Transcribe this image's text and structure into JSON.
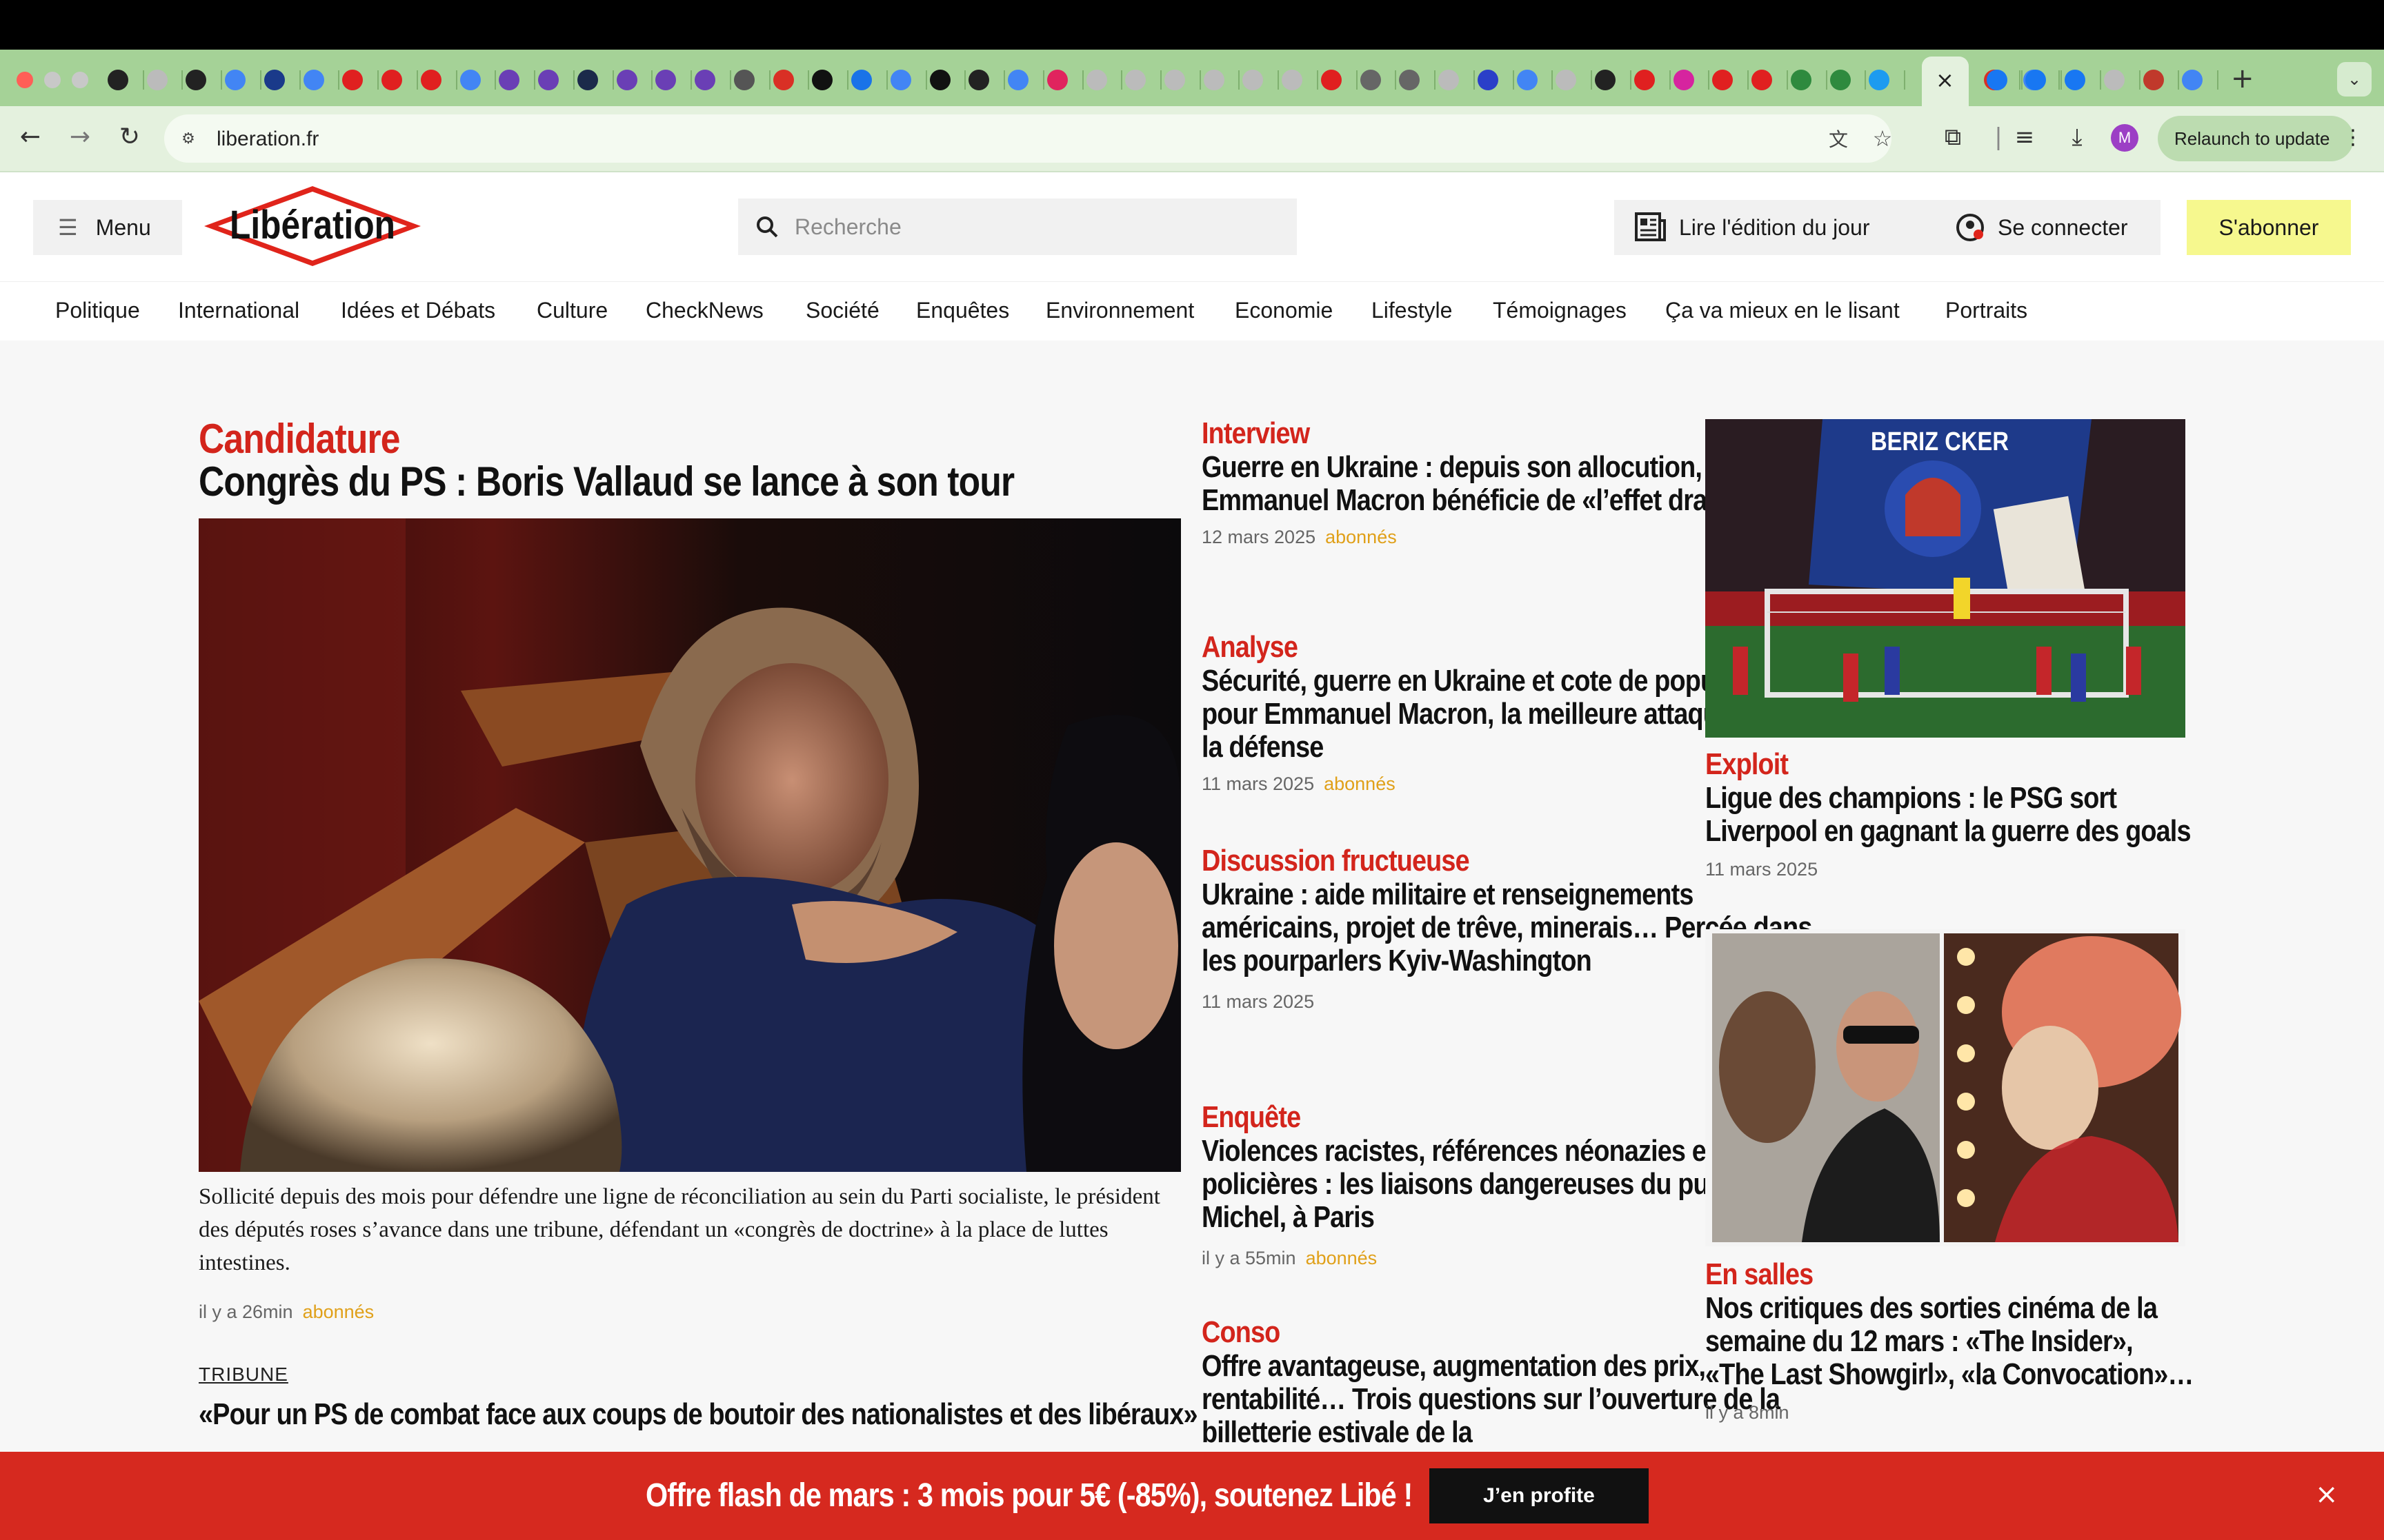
{
  "browser": {
    "url": "liberation.fr",
    "relaunch_label": "Relaunch to update",
    "avatar_letter": "M",
    "new_tab_symbol": "+",
    "close_tab_symbol": "×",
    "tab_icons": [
      {
        "icon": "openai-icon",
        "color": "#222"
      },
      {
        "icon": "tab-icon",
        "color": "#bbb"
      },
      {
        "icon": "openai-icon",
        "color": "#222"
      },
      {
        "icon": "google-icon",
        "color": "#4285f4"
      },
      {
        "icon": "dwds-icon",
        "color": "#1a3a8a"
      },
      {
        "icon": "google-icon",
        "color": "#4285f4"
      },
      {
        "icon": "youtube-icon",
        "color": "#e02020"
      },
      {
        "icon": "youtube-icon",
        "color": "#e02020"
      },
      {
        "icon": "youtube-icon",
        "color": "#e02020"
      },
      {
        "icon": "google-icon",
        "color": "#4285f4"
      },
      {
        "icon": "app-icon",
        "color": "#6a3fb5"
      },
      {
        "icon": "app-icon",
        "color": "#6a3fb5"
      },
      {
        "icon": "app-icon",
        "color": "#1b2a4a"
      },
      {
        "icon": "app-icon",
        "color": "#6a3fb5"
      },
      {
        "icon": "app-icon",
        "color": "#6a3fb5"
      },
      {
        "icon": "app-icon",
        "color": "#6a3fb5"
      },
      {
        "icon": "chrome-icon",
        "color": "#555"
      },
      {
        "icon": "gmail-icon",
        "color": "#d93025"
      },
      {
        "icon": "app-icon",
        "color": "#111"
      },
      {
        "icon": "contacts-icon",
        "color": "#1a73e8"
      },
      {
        "icon": "docs-icon",
        "color": "#4285f4"
      },
      {
        "icon": "app-icon",
        "color": "#111"
      },
      {
        "icon": "github-icon",
        "color": "#222"
      },
      {
        "icon": "google-icon",
        "color": "#4285f4"
      },
      {
        "icon": "app-icon",
        "color": "#e0245e"
      },
      {
        "icon": "tab-icon",
        "color": "#bbb"
      },
      {
        "icon": "tab-icon",
        "color": "#bbb"
      },
      {
        "icon": "tab-icon",
        "color": "#bbb"
      },
      {
        "icon": "tab-icon",
        "color": "#bbb"
      },
      {
        "icon": "tab-icon",
        "color": "#bbb"
      },
      {
        "icon": "tab-icon",
        "color": "#bbb"
      },
      {
        "icon": "youtube-icon",
        "color": "#e02020"
      },
      {
        "icon": "globe-icon",
        "color": "#666"
      },
      {
        "icon": "globe-icon",
        "color": "#666"
      },
      {
        "icon": "tab-icon",
        "color": "#bbb"
      },
      {
        "icon": "20min-icon",
        "color": "#2a3fc8"
      },
      {
        "icon": "google-icon",
        "color": "#4285f4"
      },
      {
        "icon": "tab-icon",
        "color": "#bbb"
      },
      {
        "icon": "openai-icon",
        "color": "#222"
      },
      {
        "icon": "youtube-icon",
        "color": "#e02020"
      },
      {
        "icon": "instagram-icon",
        "color": "#d6249f"
      },
      {
        "icon": "youtube-icon",
        "color": "#e02020"
      },
      {
        "icon": "youtube-icon",
        "color": "#e02020"
      },
      {
        "icon": "wordpress-icon",
        "color": "#2e8a3e"
      },
      {
        "icon": "wordpress-icon",
        "color": "#2e8a3e"
      },
      {
        "icon": "twitter-icon",
        "color": "#1d9bf0"
      },
      {
        "icon": "gmail-icon",
        "color": "#d93025"
      },
      {
        "icon": "google-icon",
        "color": "#4285f4"
      },
      {
        "icon": "facebook-icon",
        "color": "#1877f2"
      },
      {
        "icon": "facebook-icon",
        "color": "#1877f2"
      },
      {
        "icon": "facebook-icon",
        "color": "#1877f2"
      },
      {
        "icon": "tab-icon",
        "color": "#bbb"
      },
      {
        "icon": "app-icon",
        "color": "#c0392b"
      },
      {
        "icon": "google-icon",
        "color": "#4285f4"
      }
    ]
  },
  "site": {
    "menu_label": "Menu",
    "logo_text": "Libération",
    "search_placeholder": "Recherche",
    "edition_label": "Lire l'édition du jour",
    "connect_label": "Se connecter",
    "subscribe_label": "S'abonner",
    "categories": [
      "Politique",
      "International",
      "Idées et Débats",
      "Culture",
      "CheckNews",
      "Société",
      "Enquêtes",
      "Environnement",
      "Economie",
      "Lifestyle",
      "Témoignages",
      "Ça va mieux en le lisant",
      "Portraits"
    ],
    "brand_red": "#d3251c",
    "subscriber_color": "#e0a019"
  },
  "main_article": {
    "kicker": "Candidature",
    "title": "Congrès du PS : Boris Vallaud se lance à son tour",
    "description": "Sollicité depuis des mois pour défendre une ligne de réconciliation au sein du Parti socialiste, le président des députés roses s’avance dans une tribune, défendant un «congrès de doctrine» à la place de luttes intestines.",
    "time": "il y a 26min",
    "badge": "abonnés",
    "related_label": "TRIBUNE",
    "related_title": "«Pour un PS de combat face aux coups de boutoir des nationalistes et des libéraux»"
  },
  "middle_articles": [
    {
      "kicker": "Interview",
      "title": "Guerre en Ukraine : depuis son allocution, Emmanuel Macron bénéficie de «l’effet drapeau»",
      "date": "12 mars 2025",
      "badge": "abonnés"
    },
    {
      "kicker": "Analyse",
      "title": "Sécurité, guerre en Ukraine et cote de popularité : pour Emmanuel Macron, la meilleure attaque c’est la défense",
      "date": "11 mars 2025",
      "badge": "abonnés"
    },
    {
      "kicker": "Discussion fructueuse",
      "title": "Ukraine : aide militaire et renseignements américains, projet de trêve, minerais… Percée dans les pourparlers Kyiv-Washington",
      "date": "11 mars 2025",
      "badge": ""
    },
    {
      "kicker": "Enquête",
      "title": "Violences racistes, références néonazies et amitiés policières : les liaisons dangereuses du pub Saint-Michel, à Paris",
      "date": "il y a 55min",
      "badge": "abonnés"
    },
    {
      "kicker": "Conso",
      "title": "Offre avantageuse, augmentation des prix, rentabilité… Trois questions sur l’ouverture de la billetterie estivale de la",
      "date": "",
      "badge": ""
    }
  ],
  "right_articles": [
    {
      "kicker": "Exploit",
      "title": "Ligue des champions : le PSG sort Liverpool en gagnant la guerre des goals",
      "date": "11 mars 2025",
      "banner_text": "BERIZ CKER"
    },
    {
      "kicker": "En salles",
      "title": "Nos critiques des sorties cinéma de la semaine du 12 mars : «The Insider», «The Last Showgirl», «la Convocation»…",
      "date": "il y a 8min"
    }
  ],
  "promo": {
    "text": "Offre flash de mars : 3 mois pour 5€ (-85%), soutenez Libé !",
    "button": "J’en profite",
    "close_symbol": "×"
  }
}
